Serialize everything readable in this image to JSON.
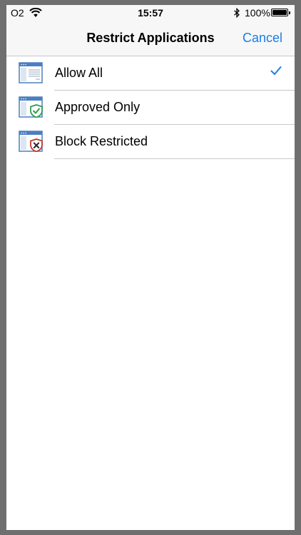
{
  "status_bar": {
    "carrier": "O2",
    "time": "15:57",
    "battery_percent": "100%",
    "icons": [
      "wifi-icon",
      "bluetooth-icon",
      "battery-icon"
    ]
  },
  "nav": {
    "title": "Restrict Applications",
    "cancel_label": "Cancel"
  },
  "options": [
    {
      "label": "Allow All",
      "icon": "window-list-icon",
      "selected": true
    },
    {
      "label": "Approved Only",
      "icon": "window-shield-check-icon",
      "selected": false
    },
    {
      "label": "Block Restricted",
      "icon": "window-shield-x-icon",
      "selected": false
    }
  ],
  "colors": {
    "accent": "#1a7ee6",
    "approved_green": "#2e9e4f",
    "restricted_red": "#c0392b",
    "window_blue": "#4a7fc1"
  }
}
